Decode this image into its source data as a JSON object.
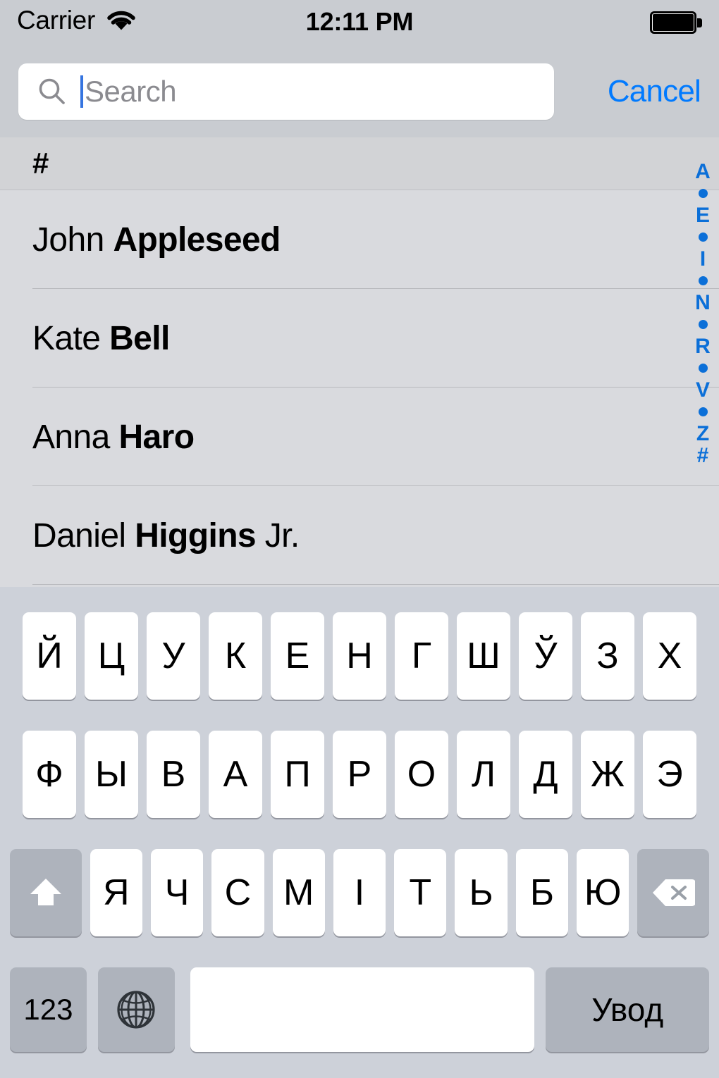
{
  "status_bar": {
    "carrier": "Carrier",
    "wifi_icon": "wifi-icon",
    "time": "12:11 PM",
    "battery_icon": "battery-full-icon"
  },
  "search": {
    "icon": "search-icon",
    "placeholder": "Search",
    "value": "",
    "cancel_label": "Cancel"
  },
  "contact_list": {
    "section_header": "#",
    "contacts": [
      {
        "first": "John ",
        "last": "Appleseed",
        "suffix": ""
      },
      {
        "first": "Kate ",
        "last": "Bell",
        "suffix": ""
      },
      {
        "first": "Anna ",
        "last": "Haro",
        "suffix": ""
      },
      {
        "first": "Daniel ",
        "last": "Higgins",
        "suffix": " Jr."
      }
    ]
  },
  "index_bar": {
    "entries": [
      "A",
      "•",
      "E",
      "•",
      "I",
      "•",
      "N",
      "•",
      "R",
      "•",
      "V",
      "•",
      "Z",
      "#"
    ]
  },
  "keyboard": {
    "language": "Belarusian",
    "row1": [
      "Й",
      "Ц",
      "У",
      "К",
      "Е",
      "Н",
      "Г",
      "Ш",
      "Ў",
      "З",
      "Х"
    ],
    "row2": [
      "Ф",
      "Ы",
      "В",
      "А",
      "П",
      "Р",
      "О",
      "Л",
      "Д",
      "Ж",
      "Э"
    ],
    "row3": [
      "Я",
      "Ч",
      "С",
      "М",
      "І",
      "Т",
      "Ь",
      "Б",
      "Ю"
    ],
    "shift_icon": "shift-icon",
    "backspace_icon": "backspace-icon",
    "numeric_label": "123",
    "globe_icon": "globe-icon",
    "space_label": "",
    "return_label": "Увод"
  },
  "colors": {
    "accent_blue": "#007AFF",
    "index_blue": "#0b6fd8",
    "chrome_gray": "#c9ccd1",
    "list_gray": "#d9dade",
    "keyboard_gray": "#cdd1d9",
    "key_white": "#ffffff",
    "key_func_gray": "#aeb3bc"
  }
}
